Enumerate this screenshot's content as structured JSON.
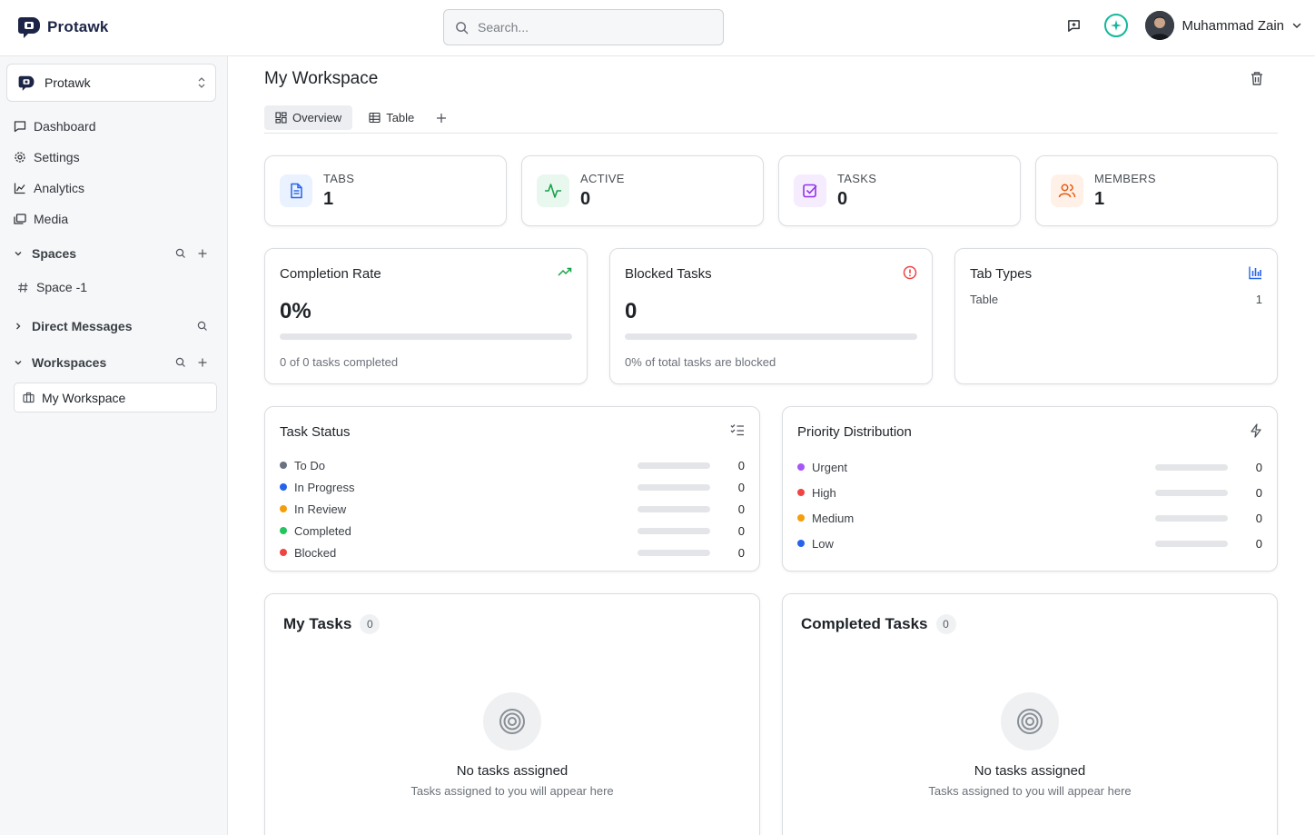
{
  "app": {
    "name": "Protawk"
  },
  "search": {
    "placeholder": "Search..."
  },
  "user": {
    "name": "Muhammad Zain"
  },
  "sidebar": {
    "org": "Protawk",
    "nav": [
      {
        "label": "Dashboard",
        "icon": "message-square-icon"
      },
      {
        "label": "Settings",
        "icon": "gear-icon"
      },
      {
        "label": "Analytics",
        "icon": "chart-icon"
      },
      {
        "label": "Media",
        "icon": "images-icon"
      }
    ],
    "spaces": {
      "label": "Spaces",
      "items": [
        {
          "label": "Space -1"
        }
      ]
    },
    "direct_messages": {
      "label": "Direct Messages"
    },
    "workspaces": {
      "label": "Workspaces",
      "items": [
        {
          "label": "My Workspace"
        }
      ]
    }
  },
  "main": {
    "title": "My Workspace",
    "tabs": [
      {
        "label": "Overview",
        "active": true
      },
      {
        "label": "Table",
        "active": false
      }
    ],
    "stats": [
      {
        "label": "TABS",
        "value": "1",
        "icon": "file-text-icon",
        "color": "#2563eb",
        "bg": "#eaf1ff"
      },
      {
        "label": "ACTIVE",
        "value": "0",
        "icon": "activity-icon",
        "color": "#16a34a",
        "bg": "#e9f8ef"
      },
      {
        "label": "TASKS",
        "value": "0",
        "icon": "check-square-icon",
        "color": "#9333ea",
        "bg": "#f5ecfe"
      },
      {
        "label": "MEMBERS",
        "value": "1",
        "icon": "users-icon",
        "color": "#ea580c",
        "bg": "#fff1e8"
      }
    ],
    "completion": {
      "title": "Completion Rate",
      "value": "0%",
      "progress": 0,
      "sub": "0 of 0 tasks completed"
    },
    "blocked": {
      "title": "Blocked Tasks",
      "value": "0",
      "progress": 0,
      "sub": "0% of total tasks are blocked"
    },
    "tab_types": {
      "title": "Tab Types",
      "rows": [
        {
          "label": "Table",
          "value": "1"
        }
      ]
    },
    "task_status": {
      "title": "Task Status",
      "rows": [
        {
          "label": "To Do",
          "value": "0",
          "color": "#6b7280",
          "fraction": 0
        },
        {
          "label": "In Progress",
          "value": "0",
          "color": "#2563eb",
          "fraction": 0
        },
        {
          "label": "In Review",
          "value": "0",
          "color": "#f59e0b",
          "fraction": 0
        },
        {
          "label": "Completed",
          "value": "0",
          "color": "#22c55e",
          "fraction": 0
        },
        {
          "label": "Blocked",
          "value": "0",
          "color": "#ef4444",
          "fraction": 0
        }
      ]
    },
    "priority": {
      "title": "Priority Distribution",
      "rows": [
        {
          "label": "Urgent",
          "value": "0",
          "color": "#a855f7",
          "fraction": 0
        },
        {
          "label": "High",
          "value": "0",
          "color": "#ef4444",
          "fraction": 0
        },
        {
          "label": "Medium",
          "value": "0",
          "color": "#f59e0b",
          "fraction": 0
        },
        {
          "label": "Low",
          "value": "0",
          "color": "#2563eb",
          "fraction": 0
        }
      ]
    },
    "my_tasks": {
      "title": "My Tasks",
      "count": "0",
      "empty_title": "No tasks assigned",
      "empty_sub": "Tasks assigned to you will appear here"
    },
    "completed_tasks": {
      "title": "Completed Tasks",
      "count": "0",
      "empty_title": "No tasks assigned",
      "empty_sub": "Tasks assigned to you will appear here"
    }
  }
}
